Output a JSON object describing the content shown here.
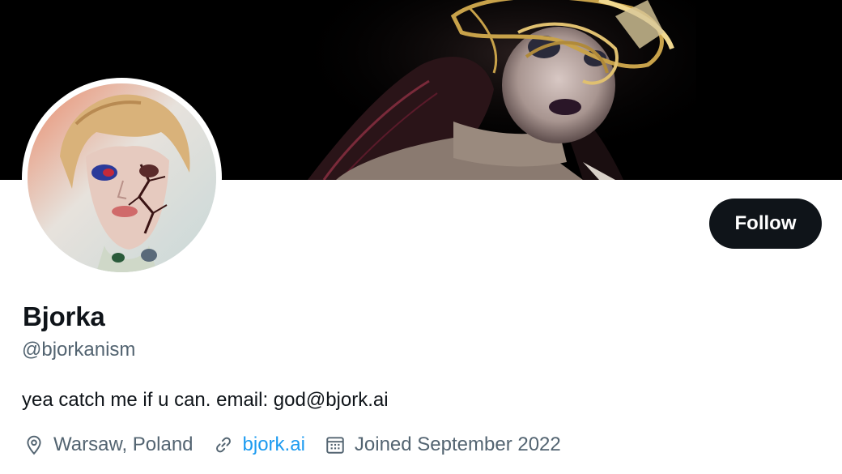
{
  "profile": {
    "display_name": "Bjorka",
    "handle": "@bjorkanism",
    "bio": "yea catch me if u can. email: god@bjork.ai",
    "location": "Warsaw, Poland",
    "website": "bjork.ai",
    "joined": "Joined September 2022"
  },
  "actions": {
    "follow_label": "Follow"
  },
  "icons": {
    "location": "location-pin-icon",
    "website": "link-icon",
    "joined": "calendar-icon"
  },
  "colors": {
    "primary_text": "#0f1419",
    "secondary_text": "#536471",
    "link": "#1d9bf0",
    "follow_button_bg": "#0f1419",
    "banner_bg": "#000000"
  }
}
